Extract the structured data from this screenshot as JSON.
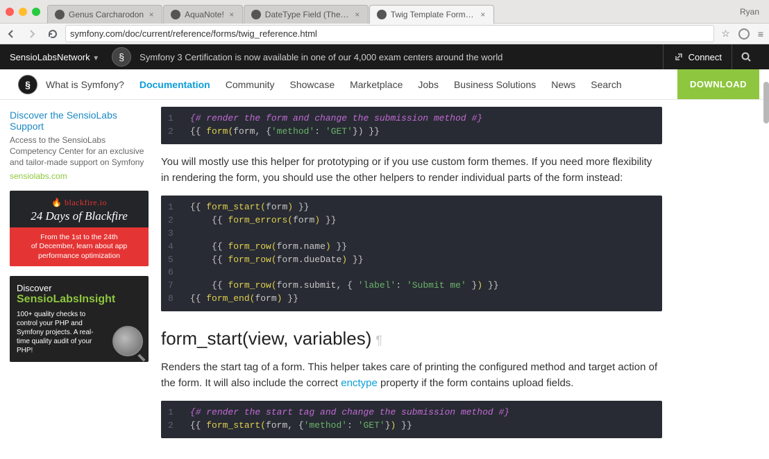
{
  "browser": {
    "tabs": [
      {
        "title": "Genus Carcharodon"
      },
      {
        "title": "AquaNote!"
      },
      {
        "title": "DateType Field (The Symfo"
      },
      {
        "title": "Twig Template Form Functi"
      }
    ],
    "user": "Ryan",
    "url": "symfony.com/doc/current/reference/forms/twig_reference.html"
  },
  "sensio": {
    "brand1": "SensioLabs",
    "brand2": "Network",
    "promo": "Symfony 3 Certification is now available in one of our 4,000 exam centers around the world",
    "connect": "Connect"
  },
  "nav": {
    "what": "What is Symfony?",
    "items": [
      "Documentation",
      "Community",
      "Showcase",
      "Marketplace",
      "Jobs",
      "Business Solutions",
      "News",
      "Search"
    ],
    "download": "DOWNLOAD"
  },
  "sidebar": {
    "support": {
      "title": "Discover the SensioLabs Support",
      "text": "Access to the SensioLabs Competency Center for an exclusive and tailor-made support on Symfony",
      "link": "sensiolabs.com"
    },
    "blackfire": {
      "brand": "blackfire.io",
      "days": "24 Days of Blackfire",
      "promo1": "From the 1st to the 24th",
      "promo2": "of December, learn about app performance optimization"
    },
    "insight": {
      "disc": "Discover",
      "brand1": "SensioLabs",
      "brand2": "Insight",
      "text": "100+ quality checks to control your PHP and Symfony projects. A real-time quality audit of your PHP!"
    }
  },
  "content": {
    "code1": {
      "comment": "{# render the form and change the submission method #}",
      "line2_a": "{{ ",
      "line2_fn": "form",
      "line2_b": "(",
      "line2_arg": "form",
      "line2_c": ", {",
      "line2_k": "'method'",
      "line2_d": ": ",
      "line2_v": "'GET'",
      "line2_e": "}) }}",
      "gutter": [
        "1",
        "2"
      ]
    },
    "para1": "You will mostly use this helper for prototyping or if you use custom form themes. If you need more flexibility in rendering the form, you should use the other helpers to render individual parts of the form instead:",
    "code2": {
      "gutter": [
        "1",
        "2",
        "3",
        "4",
        "5",
        "6",
        "7",
        "8"
      ],
      "l1": "{{ form_start(form) }}",
      "l2": "    {{ form_errors(form) }}",
      "l3": "",
      "l4": "    {{ form_row(form.name) }}",
      "l5": "    {{ form_row(form.dueDate) }}",
      "l6": "",
      "l7": "    {{ form_row(form.submit, { 'label': 'Submit me' }) }}",
      "l8": "{{ form_end(form) }}"
    },
    "h2": "form_start(view, variables)",
    "para2a": "Renders the start tag of a form. This helper takes care of printing the configured method and target action of the form. It will also include the correct ",
    "enctype": "enctype",
    "para2b": " property if the form contains upload fields.",
    "code3": {
      "gutter": [
        "1",
        "2"
      ],
      "comment": "{# render the start tag and change the submission method #}",
      "line2": "{{ form_start(form, {'method': 'GET'}) }}"
    }
  }
}
